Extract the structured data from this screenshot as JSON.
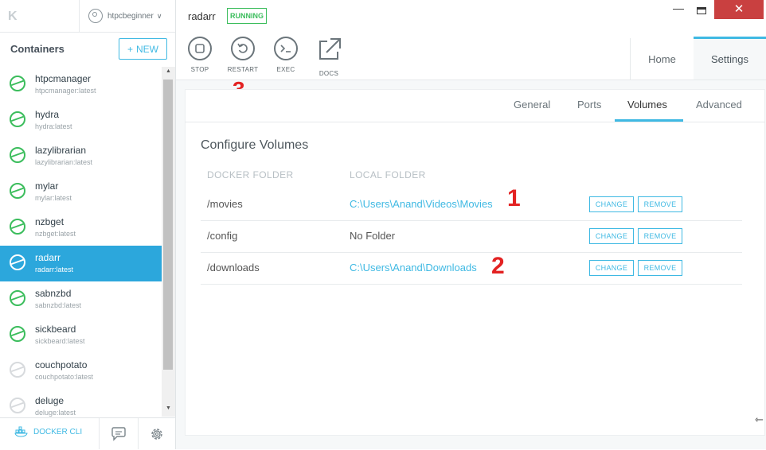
{
  "app": {
    "logo": "K"
  },
  "user": {
    "name": "htpcbeginner",
    "chevron": "∨"
  },
  "sidebar": {
    "title": "Containers",
    "new_label": "NEW",
    "new_plus": "+",
    "items": [
      {
        "name": "htpcmanager",
        "image": "htpcmanager:latest",
        "status": "running"
      },
      {
        "name": "hydra",
        "image": "hydra:latest",
        "status": "running"
      },
      {
        "name": "lazylibrarian",
        "image": "lazylibrarian:latest",
        "status": "running"
      },
      {
        "name": "mylar",
        "image": "mylar:latest",
        "status": "running"
      },
      {
        "name": "nzbget",
        "image": "nzbget:latest",
        "status": "running"
      },
      {
        "name": "radarr",
        "image": "radarr:latest",
        "status": "running",
        "active": true
      },
      {
        "name": "sabnzbd",
        "image": "sabnzbd:latest",
        "status": "running"
      },
      {
        "name": "sickbeard",
        "image": "sickbeard:latest",
        "status": "running"
      },
      {
        "name": "couchpotato",
        "image": "couchpotato:latest",
        "status": "stopped"
      },
      {
        "name": "deluge",
        "image": "deluge:latest",
        "status": "stopped"
      }
    ],
    "footer": {
      "cli_label": "DOCKER CLI"
    },
    "scroll_up": "▲",
    "scroll_down": "▼"
  },
  "container": {
    "name": "radarr",
    "status": "RUNNING"
  },
  "window": {
    "minimize": "—",
    "close": "✕"
  },
  "toolbar": {
    "stop": "STOP",
    "restart": "RESTART",
    "exec": "EXEC",
    "docs": "DOCS"
  },
  "tabs": {
    "home": "Home",
    "settings": "Settings"
  },
  "subtabs": {
    "general": "General",
    "ports": "Ports",
    "volumes": "Volumes",
    "advanced": "Advanced",
    "active": "Volumes"
  },
  "volumes": {
    "title": "Configure Volumes",
    "col_docker": "DOCKER FOLDER",
    "col_local": "LOCAL FOLDER",
    "change_label": "CHANGE",
    "remove_label": "REMOVE",
    "rows": [
      {
        "docker": "/movies",
        "local": "C:\\Users\\Anand\\Videos\\Movies",
        "is_link": true,
        "annotation": "1"
      },
      {
        "docker": "/config",
        "local": "No Folder",
        "is_link": false,
        "annotation": ""
      },
      {
        "docker": "/downloads",
        "local": "C:\\Users\\Anand\\Downloads",
        "is_link": true,
        "annotation": "2"
      }
    ]
  },
  "annotations": {
    "restart": "3"
  },
  "cursor": "⇽",
  "colors": {
    "accent": "#3fb9e3",
    "running": "#3bbd5c",
    "active_bg": "#2ca7dc",
    "annotation": "#e32222",
    "close": "#c94040"
  }
}
